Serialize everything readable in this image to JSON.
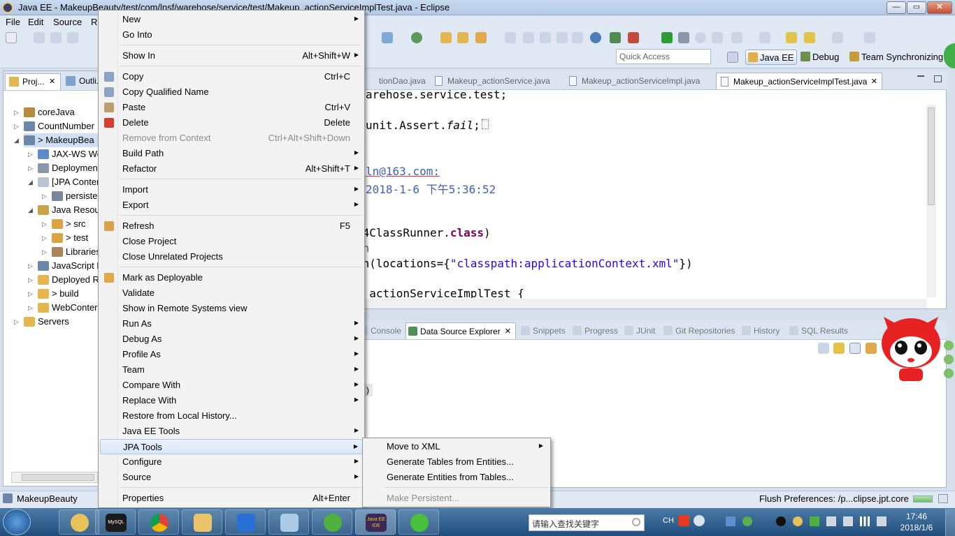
{
  "window": {
    "title": "Java EE - MakeupBeauty/test/com/lnsf/warehose/service/test/Makeup_actionServiceImplTest.java - Eclipse",
    "minimize": "—",
    "maximize": "▭",
    "close": "✕"
  },
  "menubar": [
    "File",
    "Edit",
    "Source",
    "R"
  ],
  "quick_access": {
    "placeholder": "Quick Access"
  },
  "perspectives": [
    {
      "label": "Java EE",
      "active": true
    },
    {
      "label": "Debug",
      "active": false
    },
    {
      "label": "Team Synchronizing",
      "active": false
    }
  ],
  "explorer": {
    "tabs": [
      {
        "label": "Proj...",
        "close": "✕"
      },
      {
        "label": "Outli..."
      }
    ],
    "items": [
      {
        "label": "coreJava"
      },
      {
        "label": "CountNumber"
      },
      {
        "label": "> MakeupBea"
      },
      {
        "label": "JAX-WS We"
      },
      {
        "label": "Deploymen"
      },
      {
        "label": "[JPA Conter"
      },
      {
        "label": "persiste"
      },
      {
        "label": "Java Resou"
      },
      {
        "label": "> src"
      },
      {
        "label": "> test"
      },
      {
        "label": "Libraries"
      },
      {
        "label": "JavaScript R"
      },
      {
        "label": "Deployed R"
      },
      {
        "label": "> build"
      },
      {
        "label": "WebConter"
      },
      {
        "label": "Servers"
      }
    ]
  },
  "editor": {
    "tabs": [
      {
        "label": "tionDao.java"
      },
      {
        "label": "Makeup_actionService.java"
      },
      {
        "label": "Makeup_actionServiceImpl.java"
      },
      {
        "label": "Makeup_actionServiceImplTest.java",
        "close": "✕"
      }
    ],
    "lines": {
      "l1": "arehose.service.test;",
      "l2a": "unit.Assert.",
      "l2b": "fail",
      "l2c": ";",
      "l3": "ln@163.com:",
      "l4": "2018-1-6 下午5:36:52",
      "l5a": "t4ClassRunner.",
      "l5b": "class",
      "l5c": ")",
      "l6": "on",
      "l7a": "on(locations={",
      "l7b": "\"classpath:applicationContext.xml\"",
      "l7c": "})",
      "l8": "p_actionServiceImplTest {"
    }
  },
  "bottom_panel": {
    "tabs": [
      {
        "label": "Console"
      },
      {
        "label": "Data Source Explorer",
        "close": "✕",
        "active": true
      },
      {
        "label": "Snippets"
      },
      {
        "label": "Progress"
      },
      {
        "label": "JUnit"
      },
      {
        "label": "Git Repositories"
      },
      {
        "label": "History"
      },
      {
        "label": "SQL Results"
      }
    ],
    "fragment": ")"
  },
  "context_menu": {
    "items": [
      {
        "label": "New",
        "shortcut": "",
        "submenu": true
      },
      {
        "label": "Go Into",
        "shortcut": ""
      },
      {
        "label": "Show In",
        "shortcut": "Alt+Shift+W",
        "submenu": true
      },
      {
        "label": "Copy",
        "shortcut": "Ctrl+C",
        "icon": "copy-icon"
      },
      {
        "label": "Copy Qualified Name",
        "shortcut": "",
        "icon": "copy-qualified-icon"
      },
      {
        "label": "Paste",
        "shortcut": "Ctrl+V",
        "icon": "paste-icon"
      },
      {
        "label": "Delete",
        "shortcut": "Delete",
        "icon": "delete-icon"
      },
      {
        "label": "Remove from Context",
        "shortcut": "Ctrl+Alt+Shift+Down",
        "disabled": true
      },
      {
        "label": "Build Path",
        "shortcut": "",
        "submenu": true
      },
      {
        "label": "Refactor",
        "shortcut": "Alt+Shift+T",
        "submenu": true
      },
      {
        "label": "Import",
        "shortcut": "",
        "submenu": true
      },
      {
        "label": "Export",
        "shortcut": "",
        "submenu": true
      },
      {
        "label": "Refresh",
        "shortcut": "F5",
        "icon": "refresh-icon"
      },
      {
        "label": "Close Project",
        "shortcut": ""
      },
      {
        "label": "Close Unrelated Projects",
        "shortcut": ""
      },
      {
        "label": "Mark as Deployable",
        "shortcut": "",
        "icon": "deploy-icon"
      },
      {
        "label": "Validate",
        "shortcut": ""
      },
      {
        "label": "Show in Remote Systems view",
        "shortcut": ""
      },
      {
        "label": "Run As",
        "shortcut": "",
        "submenu": true
      },
      {
        "label": "Debug As",
        "shortcut": "",
        "submenu": true
      },
      {
        "label": "Profile As",
        "shortcut": "",
        "submenu": true
      },
      {
        "label": "Team",
        "shortcut": "",
        "submenu": true
      },
      {
        "label": "Compare With",
        "shortcut": "",
        "submenu": true
      },
      {
        "label": "Replace With",
        "shortcut": "",
        "submenu": true
      },
      {
        "label": "Restore from Local History...",
        "shortcut": ""
      },
      {
        "label": "Java EE Tools",
        "shortcut": "",
        "submenu": true
      },
      {
        "label": "JPA Tools",
        "shortcut": "",
        "submenu": true,
        "highlighted": true
      },
      {
        "label": "Configure",
        "shortcut": "",
        "submenu": true
      },
      {
        "label": "Source",
        "shortcut": "",
        "submenu": true
      },
      {
        "label": "Properties",
        "shortcut": "Alt+Enter"
      }
    ]
  },
  "jpa_submenu": {
    "items": [
      {
        "label": "Move to XML",
        "submenu": true
      },
      {
        "label": "Generate Tables from Entities..."
      },
      {
        "label": "Generate Entities from Tables..."
      },
      {
        "label": "Make Persistent...",
        "disabled": true
      }
    ]
  },
  "statusbar": {
    "selected": "MakeupBeauty",
    "job": "Flush Preferences: /p...clipse.jpt.core"
  },
  "taskbar": {
    "search_placeholder": "请输入查找关键字",
    "ime": "CH",
    "time": "17:46",
    "date": "2018/1/6",
    "apps": [
      "mysql-icon",
      "chrome-icon",
      "explorer-icon",
      "wps-icon",
      "notepad-icon",
      "sync-icon",
      "eclipse-icon",
      "wechat-icon"
    ],
    "eclipse_label": "Java EE IDE",
    "mysql_label": "MySQL"
  },
  "colors": {
    "menu_highlight": "#d8e7f9",
    "keyword": "#7f0055",
    "string": "#2a00ff",
    "comment": "#3f5fbf"
  }
}
